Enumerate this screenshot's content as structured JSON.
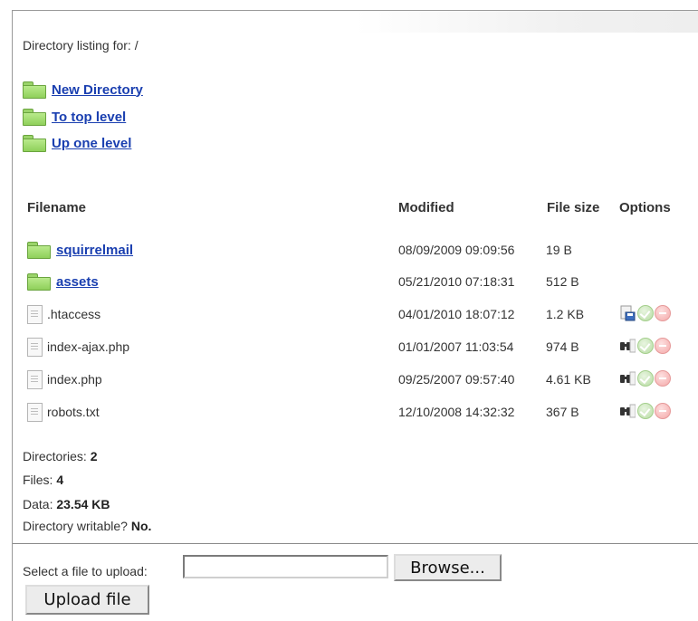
{
  "header": {
    "directory_label": "Directory listing for: /"
  },
  "nav_links": [
    {
      "label": "New Directory",
      "icon": "folder-icon"
    },
    {
      "label": "To top level",
      "icon": "folder-icon"
    },
    {
      "label": "Up one level",
      "icon": "folder-icon"
    }
  ],
  "table": {
    "headers": {
      "filename": "Filename",
      "modified": "Modified",
      "size": "File size",
      "options": "Options"
    },
    "rows": [
      {
        "type": "dir",
        "name": "squirrelmail",
        "modified": "08/09/2009 09:09:56",
        "size": "19 B",
        "options": []
      },
      {
        "type": "dir",
        "name": "assets",
        "modified": "05/21/2010 07:18:31",
        "size": "512 B",
        "options": []
      },
      {
        "type": "file",
        "name": ".htaccess",
        "modified": "04/01/2010 18:07:12",
        "size": "1.2 KB",
        "options": [
          "edit-file-icon",
          "approve-icon",
          "delete-icon"
        ]
      },
      {
        "type": "file",
        "name": "index-ajax.php",
        "modified": "01/01/2007 11:03:54",
        "size": "974 B",
        "options": [
          "view-binoculars-icon",
          "approve-icon",
          "delete-icon"
        ]
      },
      {
        "type": "file",
        "name": "index.php",
        "modified": "09/25/2007 09:57:40",
        "size": "4.61 KB",
        "options": [
          "view-binoculars-icon",
          "approve-icon",
          "delete-icon"
        ]
      },
      {
        "type": "file",
        "name": "robots.txt",
        "modified": "12/10/2008 14:32:32",
        "size": "367 B",
        "options": [
          "view-binoculars-icon",
          "approve-icon",
          "delete-icon"
        ]
      }
    ]
  },
  "stats": {
    "dirs_label": "Directories:",
    "dirs_value": "2",
    "files_label": "Files:",
    "files_value": "4",
    "data_label": "Data:",
    "data_value": "23.54 KB",
    "writable_label": "Directory writable?",
    "writable_value": "No."
  },
  "upload": {
    "label": "Select a file to upload:",
    "input_value": "",
    "browse_label": "Browse...",
    "upload_label": "Upload file"
  },
  "colors": {
    "link": "#1a3fb0",
    "folder": "#9ad36a",
    "divider": "#8a8a8a"
  }
}
